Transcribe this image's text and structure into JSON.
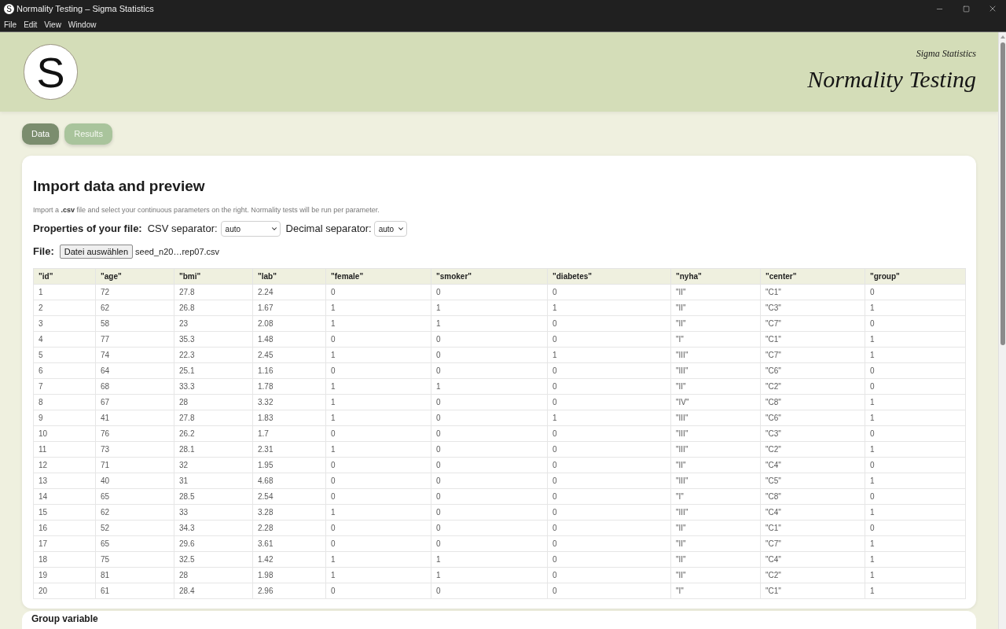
{
  "window": {
    "icon": "S",
    "title": "Normality Testing – Sigma Statistics"
  },
  "menu": [
    "File",
    "Edit",
    "View",
    "Window"
  ],
  "header": {
    "logo": "S",
    "app_name": "Sigma Statistics",
    "title": "Normality Testing"
  },
  "tabs": [
    {
      "label": "Data",
      "selected": true
    },
    {
      "label": "Results",
      "selected": false
    }
  ],
  "import_card": {
    "heading": "Import data and preview",
    "description": "Import a **.csv** file and select your continuous parameters on the right. Normality tests will be run per parameter.",
    "properties_label": "Properties of your file:",
    "csv_separator": {
      "label": "CSV separator:",
      "value": "auto"
    },
    "decimal_separator": {
      "label": "Decimal separator:",
      "value": "auto"
    },
    "file": {
      "label": "File:",
      "button": "Datei auswählen",
      "filename": "seed_n20…rep07.csv"
    }
  },
  "table": {
    "columns": [
      "\"id\"",
      "\"age\"",
      "\"bmi\"",
      "\"lab\"",
      "\"female\"",
      "\"smoker\"",
      "\"diabetes\"",
      "\"nyha\"",
      "\"center\"",
      "\"group\""
    ],
    "rows": [
      [
        "1",
        "72",
        "27.8",
        "2.24",
        "0",
        "0",
        "0",
        "\"II\"",
        "\"C1\"",
        "0"
      ],
      [
        "2",
        "62",
        "26.8",
        "1.67",
        "1",
        "1",
        "1",
        "\"II\"",
        "\"C3\"",
        "1"
      ],
      [
        "3",
        "58",
        "23",
        "2.08",
        "1",
        "1",
        "0",
        "\"II\"",
        "\"C7\"",
        "0"
      ],
      [
        "4",
        "77",
        "35.3",
        "1.48",
        "0",
        "0",
        "0",
        "\"I\"",
        "\"C1\"",
        "1"
      ],
      [
        "5",
        "74",
        "22.3",
        "2.45",
        "1",
        "0",
        "1",
        "\"III\"",
        "\"C7\"",
        "1"
      ],
      [
        "6",
        "64",
        "25.1",
        "1.16",
        "0",
        "0",
        "0",
        "\"III\"",
        "\"C6\"",
        "0"
      ],
      [
        "7",
        "68",
        "33.3",
        "1.78",
        "1",
        "1",
        "0",
        "\"II\"",
        "\"C2\"",
        "0"
      ],
      [
        "8",
        "67",
        "28",
        "3.32",
        "1",
        "0",
        "0",
        "\"IV\"",
        "\"C8\"",
        "1"
      ],
      [
        "9",
        "41",
        "27.8",
        "1.83",
        "1",
        "0",
        "1",
        "\"III\"",
        "\"C6\"",
        "1"
      ],
      [
        "10",
        "76",
        "26.2",
        "1.7",
        "0",
        "0",
        "0",
        "\"III\"",
        "\"C3\"",
        "0"
      ],
      [
        "11",
        "73",
        "28.1",
        "2.31",
        "1",
        "0",
        "0",
        "\"III\"",
        "\"C2\"",
        "1"
      ],
      [
        "12",
        "71",
        "32",
        "1.95",
        "0",
        "0",
        "0",
        "\"II\"",
        "\"C4\"",
        "0"
      ],
      [
        "13",
        "40",
        "31",
        "4.68",
        "0",
        "0",
        "0",
        "\"III\"",
        "\"C5\"",
        "1"
      ],
      [
        "14",
        "65",
        "28.5",
        "2.54",
        "0",
        "0",
        "0",
        "\"I\"",
        "\"C8\"",
        "0"
      ],
      [
        "15",
        "62",
        "33",
        "3.28",
        "1",
        "0",
        "0",
        "\"III\"",
        "\"C4\"",
        "1"
      ],
      [
        "16",
        "52",
        "34.3",
        "2.28",
        "0",
        "0",
        "0",
        "\"II\"",
        "\"C1\"",
        "0"
      ],
      [
        "17",
        "65",
        "29.6",
        "3.61",
        "0",
        "0",
        "0",
        "\"II\"",
        "\"C7\"",
        "1"
      ],
      [
        "18",
        "75",
        "32.5",
        "1.42",
        "1",
        "1",
        "0",
        "\"II\"",
        "\"C4\"",
        "1"
      ],
      [
        "19",
        "81",
        "28",
        "1.98",
        "1",
        "1",
        "0",
        "\"II\"",
        "\"C2\"",
        "1"
      ],
      [
        "20",
        "61",
        "28.4",
        "2.96",
        "0",
        "0",
        "0",
        "\"I\"",
        "\"C1\"",
        "1"
      ]
    ]
  },
  "group_card": {
    "heading": "Group variable"
  }
}
